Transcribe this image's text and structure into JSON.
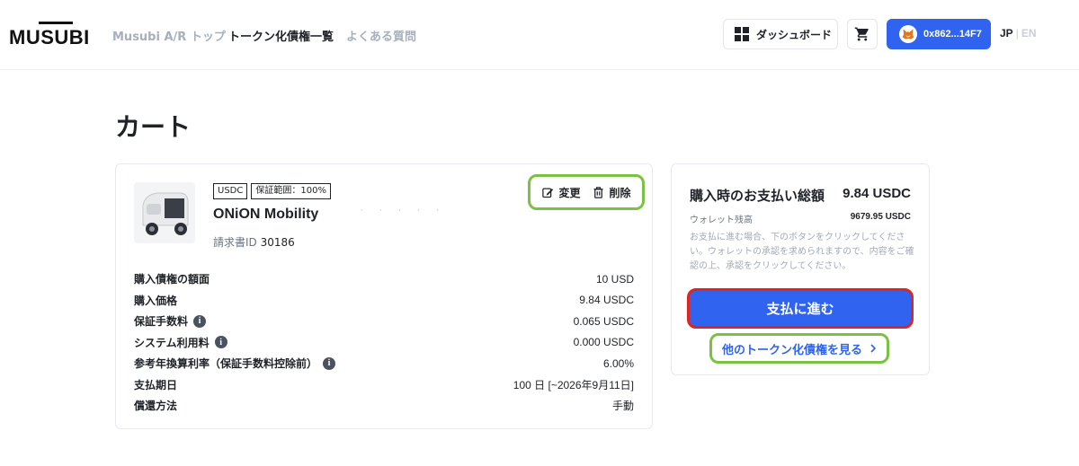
{
  "header": {
    "logo_text": "MUSUBI",
    "nav": [
      {
        "label": "Musubi A/R トップ"
      },
      {
        "label": "トークン化債権一覧"
      },
      {
        "label": "よくある質問"
      }
    ],
    "dashboard_label": "ダッシュボード",
    "wallet_address": "0x862...14F7",
    "lang_jp": "JP",
    "lang_sep": "|",
    "lang_en": "EN"
  },
  "page": {
    "title": "カート"
  },
  "item": {
    "badges": [
      "USDC",
      "保証範囲：100%"
    ],
    "name": "ONiON Mobility",
    "invoice_label": "請求書ID",
    "invoice_id": "30186",
    "edit_label": "変更",
    "delete_label": "削除",
    "details": [
      {
        "label": "購入債権の額面",
        "value": "10 USD"
      },
      {
        "label": "購入価格",
        "value": "9.84 USDC"
      },
      {
        "label": "保証手数料",
        "value": "0.065 USDC"
      },
      {
        "label": "システム利用料",
        "value": "0.000 USDC"
      },
      {
        "label": "参考年換算利率（保証手数料控除前）",
        "value": "6.00%"
      },
      {
        "label": "支払期日",
        "value": "100 日 [~2026年9月11日]"
      },
      {
        "label": "償還方法",
        "value": "手動"
      }
    ]
  },
  "summary": {
    "title": "購入時のお支払い総額",
    "total": "9.84 USDC",
    "balance_label": "ウォレット残高",
    "balance_value": "9679.95 USDC",
    "note": "お支払に進む場合、下のボタンをクリックしてください。ウォレットの承認を求められますので、内容をご確認の上、承認をクリックしてください。",
    "pay_button": "支払に進む",
    "more_link": "他のトークン化債権を見る"
  },
  "colors": {
    "accent": "#2f63f0",
    "highlight_green": "#7cc242",
    "highlight_red": "#e02424"
  }
}
